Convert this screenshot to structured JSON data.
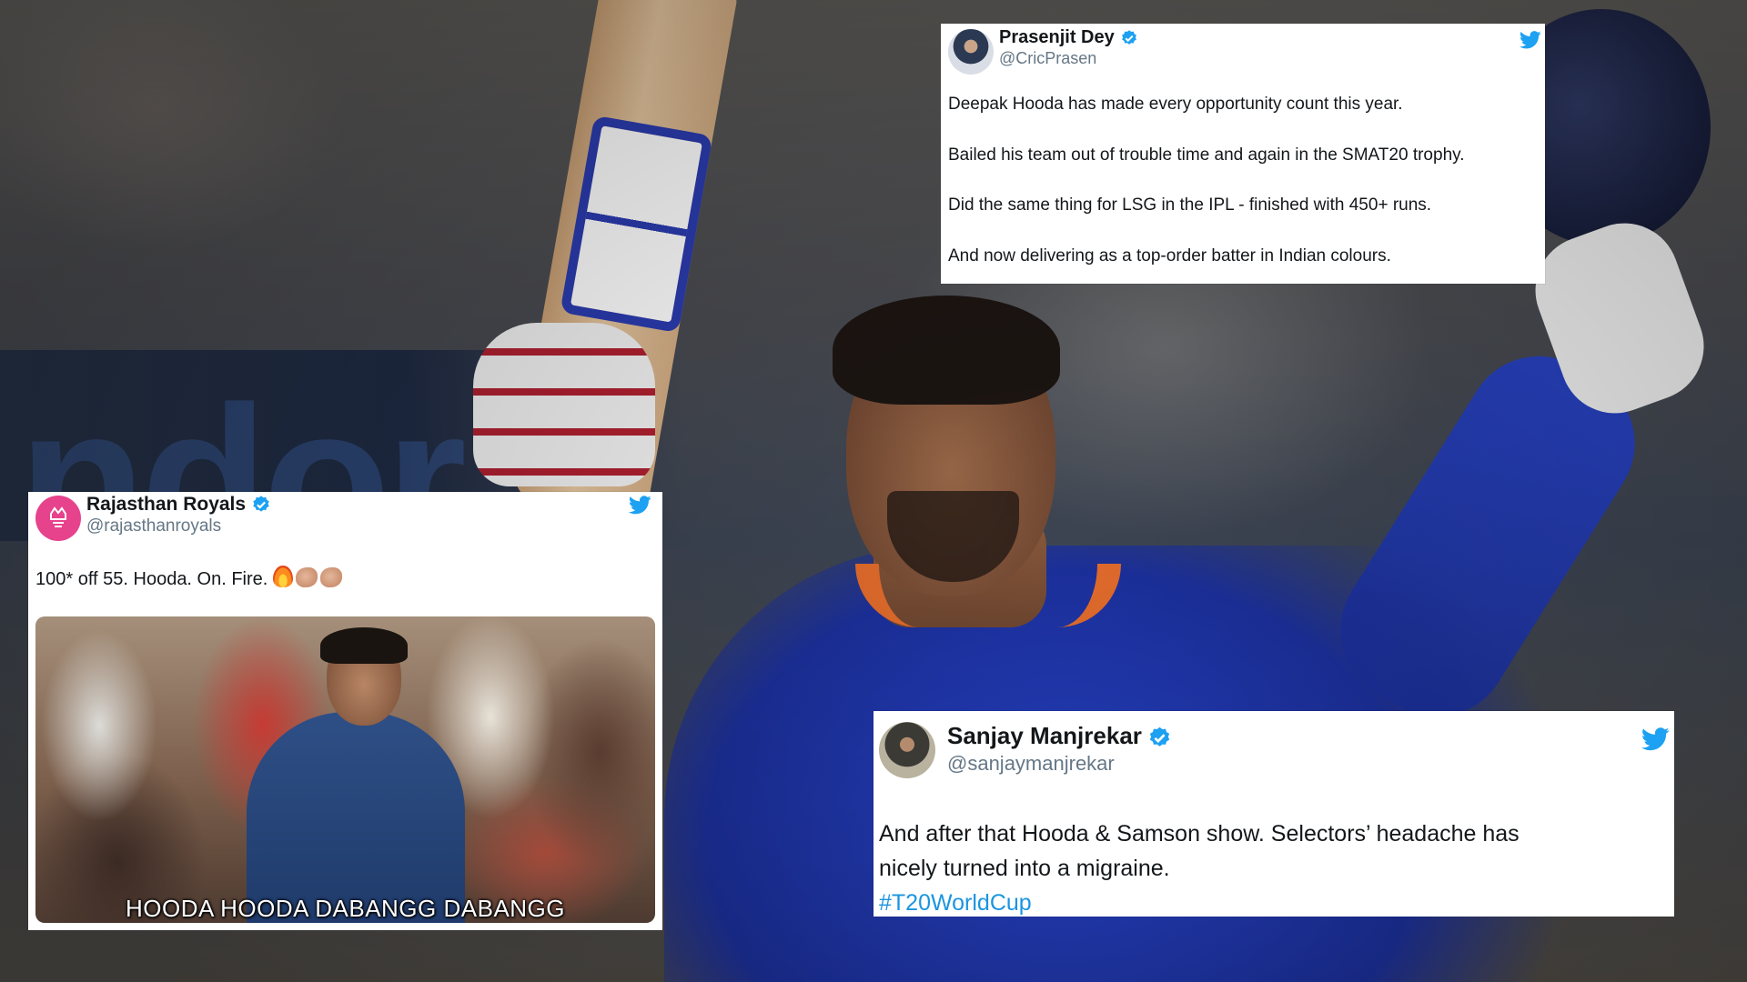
{
  "tweets": [
    {
      "name": "Prasenjit Dey",
      "handle": "@CricPrasen",
      "paragraphs": [
        "Deepak Hooda has made every opportunity count this year.",
        "Bailed his team out of trouble time and again in the SMAT20 trophy.",
        "Did the same thing for LSG in the IPL - finished with 450+ runs.",
        "And now delivering as a top-order batter in Indian colours."
      ]
    },
    {
      "name": "Rajasthan Royals",
      "handle": "@rajasthanroyals",
      "text": "100* off 55. Hooda. On. Fire.",
      "emojis": [
        "fire-emoji",
        "clapping-hands-emoji",
        "clapping-hands-emoji"
      ],
      "image_caption": "HOODA HOODA DABANGG DABANGG"
    },
    {
      "name": "Sanjay Manjrekar",
      "handle": "@sanjaymanjrekar",
      "line1": "And after that Hooda & Samson show. Selectors’ headache has",
      "line2": "nicely turned into a migraine.",
      "hashtag": "#T20WorldCup"
    }
  ],
  "colors": {
    "twitter_blue": "#1da1f2",
    "handle_gray": "#657786",
    "hashtag_blue": "#1b95e0",
    "jersey_blue": "#2742c8",
    "royals_pink": "#e6438c"
  },
  "icons": {
    "verified": "verified-badge-icon",
    "platform": "twitter-bird-icon"
  }
}
